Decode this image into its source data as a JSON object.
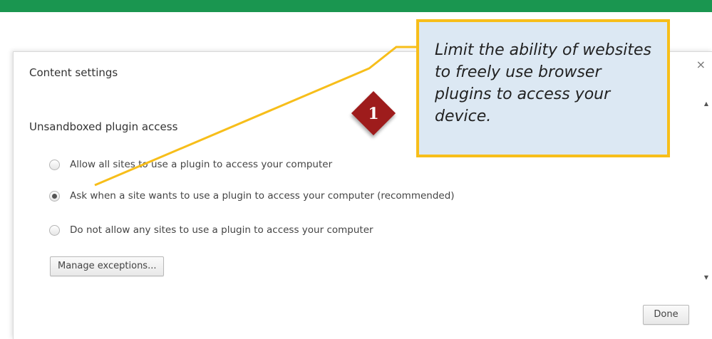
{
  "dialog": {
    "title": "Content settings",
    "close_glyph": "×",
    "section_heading": "Unsandboxed plugin access",
    "options": [
      {
        "label": "Allow all sites to use a plugin to access your computer",
        "checked": false
      },
      {
        "label": "Ask when a site wants to use a plugin to access your computer (recommended)",
        "checked": true
      },
      {
        "label": "Do not allow any sites to use a plugin to access your computer",
        "checked": false
      }
    ],
    "manage_exceptions_label": "Manage exceptions...",
    "done_label": "Done",
    "scroll_up_glyph": "▲",
    "scroll_down_glyph": "▼"
  },
  "annotation": {
    "step_number": "1",
    "callout_text": "Limit the ability of websites to freely use browser plugins to access your device.",
    "colors": {
      "callout_border": "#f7be1a",
      "callout_fill": "#dce8f3",
      "badge": "#9e1c1c",
      "leader_line": "#f7be1a"
    }
  },
  "colors": {
    "top_bar": "#1a9650"
  }
}
